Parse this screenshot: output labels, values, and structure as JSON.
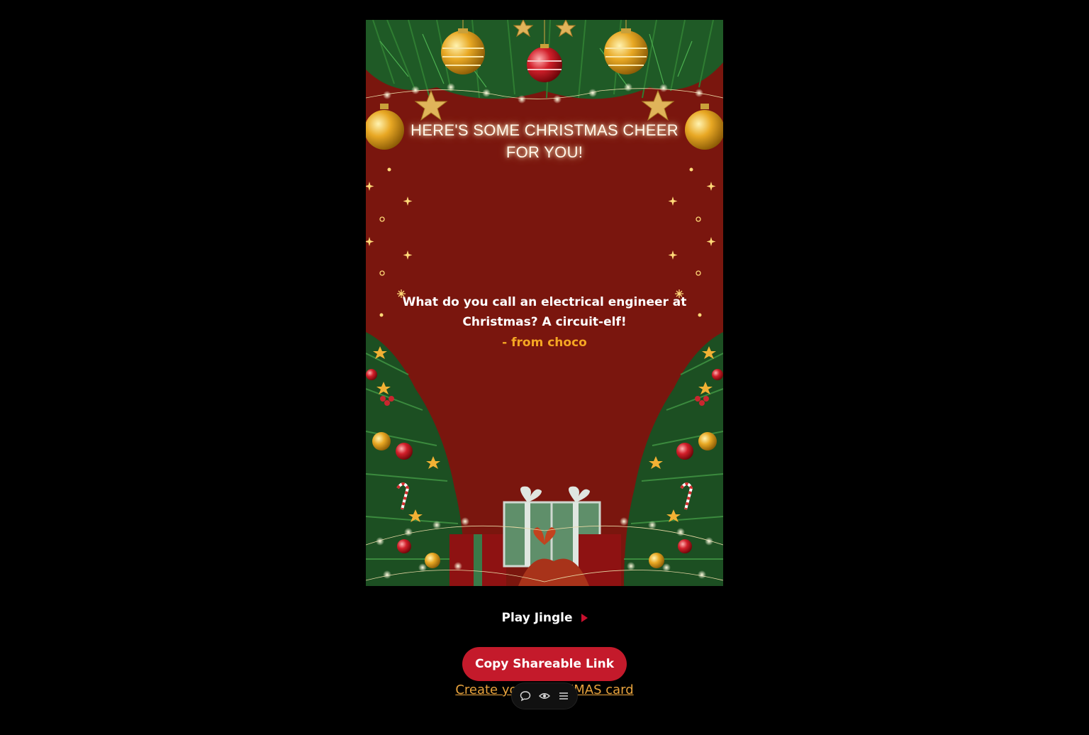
{
  "card": {
    "title": "HERE'S SOME CHRISTMAS CHEER FOR YOU!",
    "message": "What do you call an electrical engineer at Christmas? A circuit-elf!",
    "from": "- from choco",
    "background_color": "#7a160e"
  },
  "controls": {
    "play_jingle_label": "Play Jingle",
    "play_icon": "play-icon",
    "copy_link_label": "Copy Shareable Link",
    "create_link_label": "Create your own XMAS card"
  },
  "toolbar": {
    "icons": [
      "comment-icon",
      "eye-icon",
      "menu-icon"
    ]
  },
  "colors": {
    "accent_red": "#c41a2b",
    "link_gold": "#e8a33d",
    "from_orange": "#f5a623",
    "page_background": "#000000"
  }
}
